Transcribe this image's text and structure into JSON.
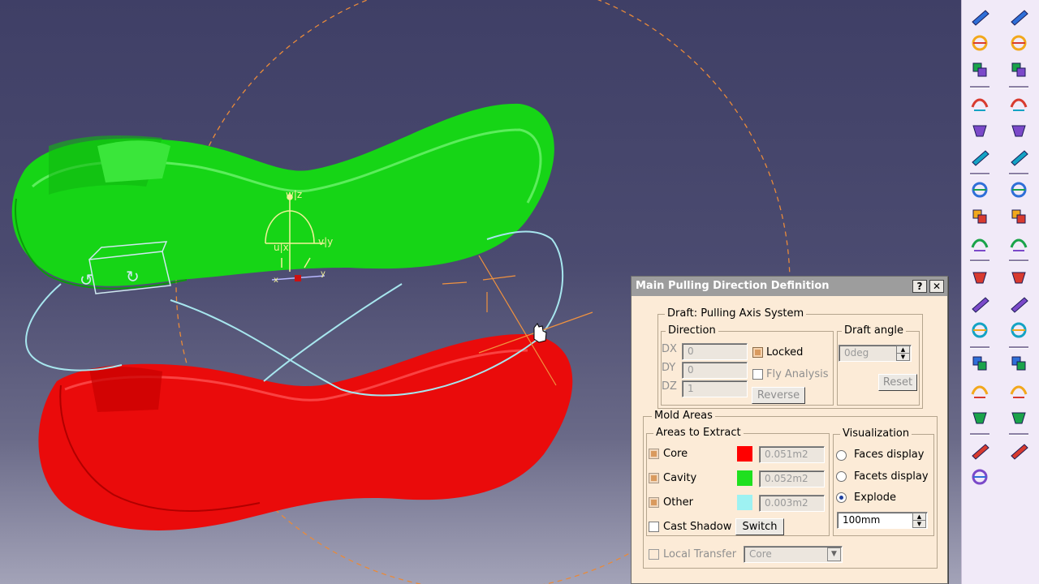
{
  "dialog": {
    "title": "Main Pulling Direction Definition",
    "help_btn": "?",
    "close_btn": "✕",
    "draft_group": "Draft: Pulling Axis System",
    "direction_group": "Direction",
    "dx_label": "DX",
    "dx_value": "0",
    "dy_label": "DY",
    "dy_value": "0",
    "dz_label": "DZ",
    "dz_value": "1",
    "locked_label": "Locked",
    "fly_label": "Fly Analysis",
    "reverse_label": "Reverse",
    "draft_angle_group": "Draft angle",
    "draft_angle_value": "0deg",
    "reset_label": "Reset",
    "mold_group": "Mold Areas",
    "extract_group": "Areas to Extract",
    "core_label": "Core",
    "core_value": "0.051m2",
    "core_color": "#ff0000",
    "cavity_label": "Cavity",
    "cavity_value": "0.052m2",
    "cavity_color": "#1fe01f",
    "other_label": "Other",
    "other_value": "0.003m2",
    "other_color": "#9ef2f2",
    "cast_shadow_label": "Cast Shadow",
    "switch_label": "Switch",
    "vis_group": "Visualization",
    "faces_label": "Faces display",
    "facets_label": "Facets display",
    "explode_label": "Explode",
    "explode_value": "100mm",
    "local_transfer_label": "Local Transfer",
    "local_transfer_value": "Core"
  },
  "viewport": {
    "axis_w_label": "w|z",
    "axis_u_label": "u|x",
    "axis_v_label": "v|y",
    "axis_small_x": "x",
    "axis_small_y": "y"
  },
  "toolbar": {
    "left_col": [
      "line-icon",
      "plane-icon",
      "sweep-icon",
      "surface-icon",
      "blend-icon",
      "undo-icon",
      "redo-icon",
      "core-cavity-icon",
      "pulling-direction-icon",
      "box-icon",
      "split-icon",
      "extrude-icon",
      "multi-surface-icon",
      "book-icon",
      "join-icon",
      "text-abc-icon",
      "annotation-icon"
    ],
    "right_col": [
      "select-arrow-icon",
      "sketch-icon",
      "tree-icon",
      "snap-icon",
      "axis-icon",
      "hierarchy-icon",
      "colors-icon",
      "patch-icon",
      "curve-icon",
      "draft-icon",
      "mirror-icon",
      "surface-blue-icon",
      "fill-icon",
      "loft-icon",
      "offset-icon",
      "blue-wave-icon"
    ]
  }
}
